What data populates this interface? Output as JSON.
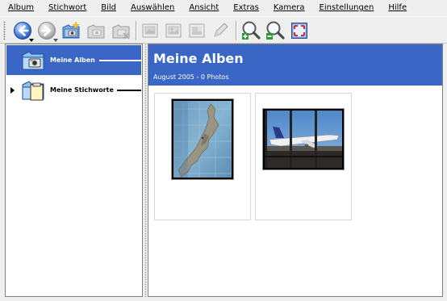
{
  "menubar": {
    "items": [
      {
        "label": "Album"
      },
      {
        "label": "Stichwort"
      },
      {
        "label": "Bild"
      },
      {
        "label": "Auswählen"
      },
      {
        "label": "Ansicht"
      },
      {
        "label": "Extras"
      },
      {
        "label": "Kamera"
      },
      {
        "label": "Einstellungen"
      },
      {
        "label": "Hilfe"
      }
    ]
  },
  "toolbar": {
    "buttons": [
      {
        "icon": "back-arrow-icon",
        "enabled": true
      },
      {
        "icon": "forward-arrow-icon",
        "enabled": false
      },
      {
        "icon": "new-album-icon",
        "enabled": true
      },
      {
        "icon": "rename-album-icon",
        "enabled": false
      },
      {
        "icon": "delete-album-icon",
        "enabled": false
      },
      {
        "icon": "album-properties-icon",
        "enabled": false
      },
      {
        "icon": "view-image-icon",
        "enabled": false
      },
      {
        "icon": "edit-image-icon",
        "enabled": false
      },
      {
        "icon": "pencil-icon",
        "enabled": false
      },
      {
        "icon": "zoom-in-icon",
        "enabled": true
      },
      {
        "icon": "zoom-out-icon",
        "enabled": true
      },
      {
        "icon": "full-screen-icon",
        "enabled": true
      }
    ]
  },
  "sidebar": {
    "items": [
      {
        "label": "Meine Alben",
        "selected": true,
        "icon": "album-folder-icon"
      },
      {
        "label": "Meine Stichworte",
        "selected": false,
        "icon": "tags-folder-icon"
      }
    ]
  },
  "main": {
    "title": "Meine Alben",
    "subtitle": "August 2005 - 0 Photos",
    "thumbnails": [
      {
        "alt": "map",
        "icon": "map-photo-icon"
      },
      {
        "alt": "airplane",
        "icon": "airplane-photo-icon"
      }
    ]
  },
  "colors": {
    "accent": "#3a66c6",
    "window_bg": "#efefef",
    "panel_bg": "#ffffff"
  }
}
